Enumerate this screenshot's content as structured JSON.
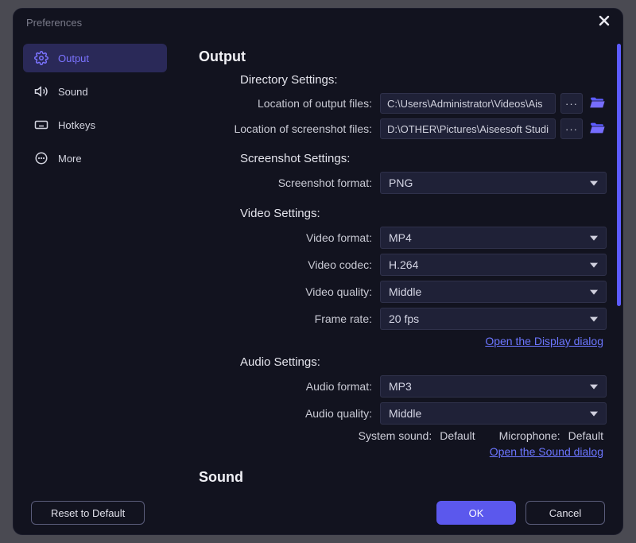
{
  "window": {
    "title": "Preferences"
  },
  "sidebar": {
    "items": [
      {
        "label": "Output"
      },
      {
        "label": "Sound"
      },
      {
        "label": "Hotkeys"
      },
      {
        "label": "More"
      }
    ]
  },
  "output": {
    "heading": "Output",
    "directory": {
      "title": "Directory Settings:",
      "output_label": "Location of output files:",
      "output_value": "C:\\Users\\Administrator\\Videos\\Ais",
      "screenshot_label": "Location of screenshot files:",
      "screenshot_value": "D:\\OTHER\\Pictures\\Aiseesoft Studi",
      "more_label": "···"
    },
    "screenshot": {
      "title": "Screenshot Settings:",
      "format_label": "Screenshot format:",
      "format_value": "PNG"
    },
    "video": {
      "title": "Video Settings:",
      "format_label": "Video format:",
      "format_value": "MP4",
      "codec_label": "Video codec:",
      "codec_value": "H.264",
      "quality_label": "Video quality:",
      "quality_value": "Middle",
      "framerate_label": "Frame rate:",
      "framerate_value": "20 fps",
      "display_link": "Open the Display dialog"
    },
    "audio": {
      "title": "Audio Settings:",
      "format_label": "Audio format:",
      "format_value": "MP3",
      "quality_label": "Audio quality:",
      "quality_value": "Middle",
      "system_sound_label": "System sound:",
      "system_sound_value": "Default",
      "microphone_label": "Microphone:",
      "microphone_value": "Default",
      "sound_link": "Open the Sound dialog"
    }
  },
  "sound": {
    "heading": "Sound"
  },
  "footer": {
    "reset": "Reset to Default",
    "ok": "OK",
    "cancel": "Cancel"
  }
}
